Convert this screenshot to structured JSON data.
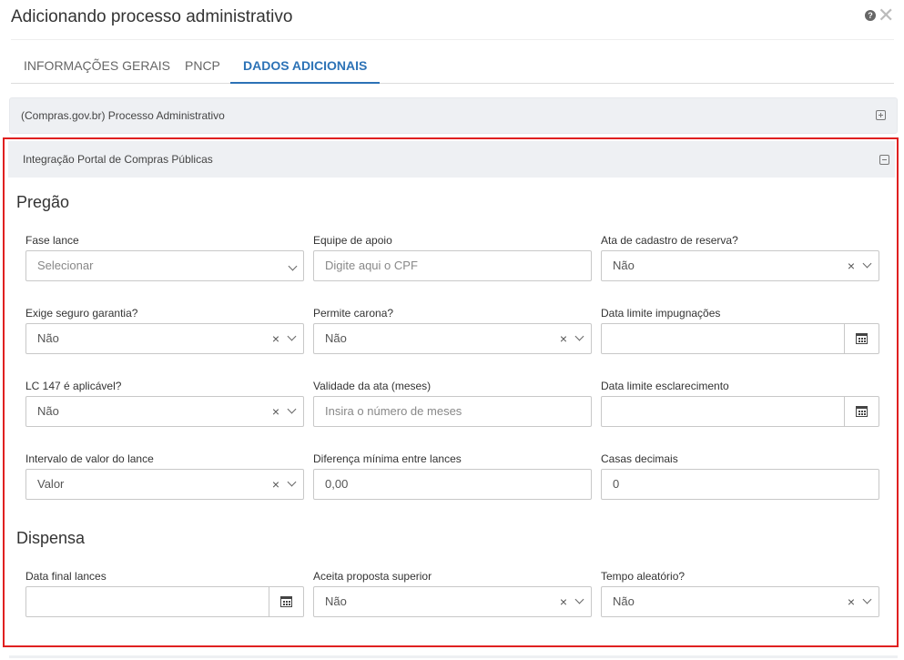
{
  "dialog": {
    "title": "Adicionando processo administrativo",
    "help_icon": "question-circle-icon",
    "close_icon": "close-icon",
    "close_glyph": "✕",
    "help_glyph": "?"
  },
  "tabs": [
    {
      "label": "INFORMAÇÕES GERAIS",
      "active": false
    },
    {
      "label": "PNCP",
      "active": false
    },
    {
      "label": "DADOS ADICIONAIS",
      "active": true
    }
  ],
  "panels": {
    "compras": {
      "title": "(Compras.gov.br) Processo Administrativo",
      "icon": "expand-plus-icon"
    },
    "integracao": {
      "title": "Integração Portal de Compras Públicas",
      "icon": "collapse-minus-icon"
    }
  },
  "sections": {
    "pregao": "Pregão",
    "dispensa": "Dispensa"
  },
  "fields": {
    "fase_lance": {
      "label": "Fase lance",
      "placeholder": "Selecionar",
      "value": ""
    },
    "equipe_apoio": {
      "label": "Equipe de apoio",
      "placeholder": "Digite aqui o CPF",
      "value": ""
    },
    "ata_cadastro_reserva": {
      "label": "Ata de cadastro de reserva?",
      "value": "Não"
    },
    "exige_seguro_garantia": {
      "label": "Exige seguro garantia?",
      "value": "Não"
    },
    "permite_carona": {
      "label": "Permite carona?",
      "value": "Não"
    },
    "data_limite_impugnacoes": {
      "label": "Data limite impugnações",
      "value": ""
    },
    "lc147_aplicavel": {
      "label": "LC 147 é aplicável?",
      "value": "Não"
    },
    "validade_ata": {
      "label": "Validade da ata (meses)",
      "placeholder": "Insira o número de meses",
      "value": ""
    },
    "data_limite_esclarecimento": {
      "label": "Data limite esclarecimento",
      "value": ""
    },
    "intervalo_valor_lance": {
      "label": "Intervalo de valor do lance",
      "value": "Valor"
    },
    "diferenca_minima_lances": {
      "label": "Diferença mínima entre lances",
      "value": "0,00"
    },
    "casas_decimais": {
      "label": "Casas decimais",
      "value": "0"
    },
    "data_final_lances": {
      "label": "Data final lances",
      "value": ""
    },
    "aceita_proposta_superior": {
      "label": "Aceita proposta superior",
      "value": "Não"
    },
    "tempo_aleatorio": {
      "label": "Tempo aleatório?",
      "value": "Não"
    }
  },
  "glyphs": {
    "clear": "×"
  },
  "colors": {
    "accent": "#2c72b6",
    "highlight_border": "#e02020",
    "panel_header_bg": "#eef0f3"
  }
}
